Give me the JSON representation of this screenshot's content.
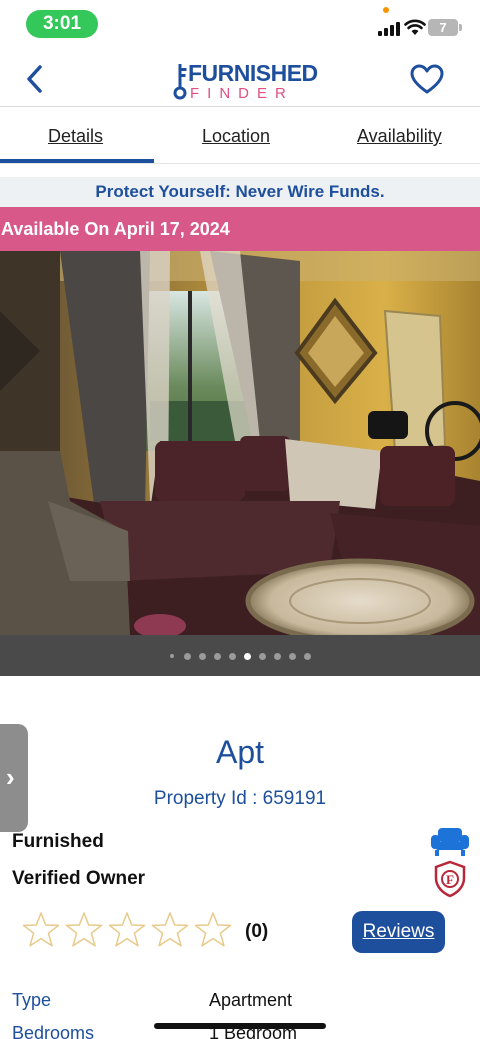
{
  "status_bar": {
    "time": "3:01",
    "battery": "7"
  },
  "header": {
    "logo_top": "FURNISHED",
    "logo_bottom": "FINDER"
  },
  "tabs": [
    {
      "label": "Details"
    },
    {
      "label": "Location"
    },
    {
      "label": "Availability"
    }
  ],
  "banners": {
    "warning": "Protect Yourself: Never Wire Funds.",
    "availability": "Available On April 17, 2024"
  },
  "gallery": {
    "total_images": 10,
    "active_index": 6
  },
  "property": {
    "title": "Apt",
    "id_text": "Property Id : 659191",
    "features": [
      "Furnished",
      "Verified Owner"
    ],
    "rating": 0,
    "max_rating": 5,
    "review_count": "(0)",
    "reviews_button": "Reviews"
  },
  "info_rows": [
    {
      "label": "Type",
      "value": "Apartment"
    },
    {
      "label": "Bedrooms",
      "value": "1 Bedroom"
    }
  ],
  "colors": {
    "brand_blue": "#1e4f9c",
    "brand_pink": "#d8588a",
    "status_green": "#34c759",
    "star_outline": "#e8c98a"
  },
  "icons": {
    "back": "chevron-left-icon",
    "favorite": "heart-icon",
    "furnished": "couch-icon",
    "verified": "shield-icon",
    "side_tab": "chevron-right-icon"
  }
}
